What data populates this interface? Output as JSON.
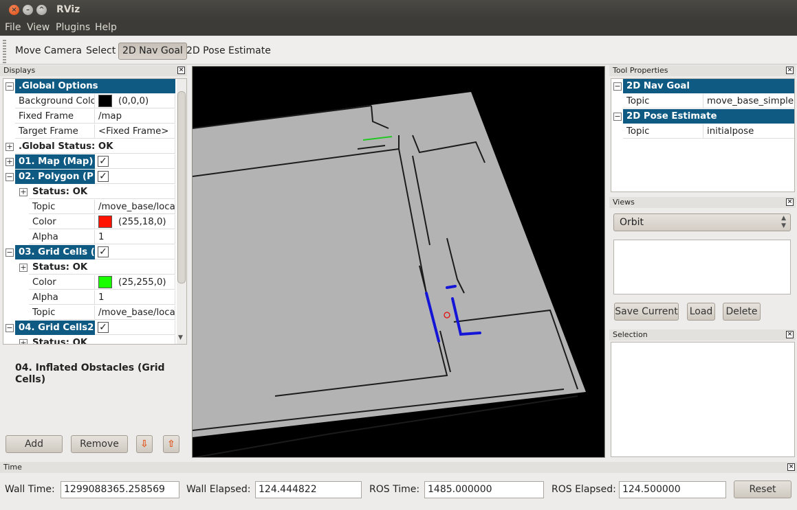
{
  "window": {
    "title": "RViz"
  },
  "menubar": {
    "file": "File",
    "view": "View",
    "plugins": "Plugins",
    "help": "Help"
  },
  "toolbar": {
    "move_camera": "Move Camera",
    "select": "Select",
    "nav_goal": "2D Nav Goal",
    "pose_estimate": "2D Pose Estimate"
  },
  "displays": {
    "title": "Displays",
    "global_options": ".Global Options",
    "bg_color_label": "Background Colo",
    "bg_color_value": "(0,0,0)",
    "bg_color": "#000000",
    "fixed_frame_label": "Fixed Frame",
    "fixed_frame_value": "/map",
    "target_frame_label": "Target Frame",
    "target_frame_value": "<Fixed Frame>",
    "global_status": ".Global Status: OK",
    "map": "01. Map (Map)",
    "polygon": "02. Polygon (P",
    "status_ok": "Status: OK",
    "topic_label": "Topic",
    "polygon_topic": "/move_base/loca",
    "color_label": "Color",
    "polygon_color_value": "(255,18,0)",
    "polygon_color": "#ff1200",
    "alpha_label": "Alpha",
    "polygon_alpha": "1",
    "grid_cells": "03. Grid Cells (",
    "grid_color_value": "(25,255,0)",
    "grid_color": "#19ff00",
    "grid_alpha": "1",
    "grid_topic": "/move_base/loca",
    "grid_cells2": "04. Grid Cells2",
    "status_ok2": "Status: OK",
    "description": "04. Inflated Obstacles (Grid Cells)",
    "add": "Add",
    "remove": "Remove"
  },
  "tool_properties": {
    "title": "Tool Properties",
    "nav_goal": "2D Nav Goal",
    "nav_topic_label": "Topic",
    "nav_topic_value": "move_base_simple",
    "pose_estimate": "2D Pose Estimate",
    "pose_topic_label": "Topic",
    "pose_topic_value": "initialpose"
  },
  "views": {
    "title": "Views",
    "selected": "Orbit",
    "save_current": "Save Current",
    "load": "Load",
    "delete": "Delete"
  },
  "selection": {
    "title": "Selection"
  },
  "time": {
    "title": "Time",
    "wall_time_label": "Wall Time:",
    "wall_time": "1299088365.258569",
    "wall_elapsed_label": "Wall Elapsed:",
    "wall_elapsed": "124.444822",
    "ros_time_label": "ROS Time:",
    "ros_time": "1485.000000",
    "ros_elapsed_label": "ROS Elapsed:",
    "ros_elapsed": "124.500000",
    "reset": "Reset"
  }
}
